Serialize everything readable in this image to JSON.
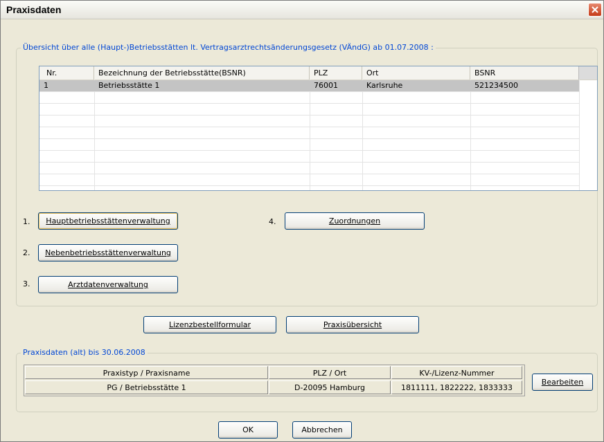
{
  "window": {
    "title": "Praxisdaten"
  },
  "overview": {
    "legend": "Übersicht über alle (Haupt-)Betriebsstätten lt. Vertragsarztrechtsänderungsgesetz (VÄndG) ab 01.07.2008 :",
    "columns": [
      "Nr.",
      "Bezeichnung der Betriebsstätte(BSNR)",
      "PLZ",
      "Ort",
      "BSNR"
    ],
    "rows": [
      {
        "nr": "1",
        "name": "Betriebsstätte 1",
        "plz": "76001",
        "ort": "Karlsruhe",
        "bsnr": "521234500"
      }
    ]
  },
  "actions": {
    "n1": "1.",
    "n2": "2.",
    "n3": "3.",
    "n4": "4.",
    "haupt": "Hauptbetriebsstättenverwaltung",
    "neben": "Nebenbetriebsstättenverwaltung",
    "arzt": "Arztdatenverwaltung",
    "zuord": "Zuordnungen",
    "lizenz": "Lizenzbestellformular",
    "praxis": "Praxisübersicht"
  },
  "old": {
    "legend": "Praxisdaten (alt) bis 30.06.2008",
    "columns": [
      "Praxistyp / Praxisname",
      "PLZ / Ort",
      "KV-/Lizenz-Nummer"
    ],
    "row": [
      "PG  / Betriebsstätte 1",
      "D-20095 Hamburg",
      "1811111, 1822222, 1833333"
    ],
    "edit": "Bearbeiten"
  },
  "footer": {
    "ok": "OK",
    "cancel": "Abbrechen"
  },
  "colors": {
    "legend": "#0046d5",
    "selection": "#c4c4c4",
    "close": "#c43a18"
  }
}
